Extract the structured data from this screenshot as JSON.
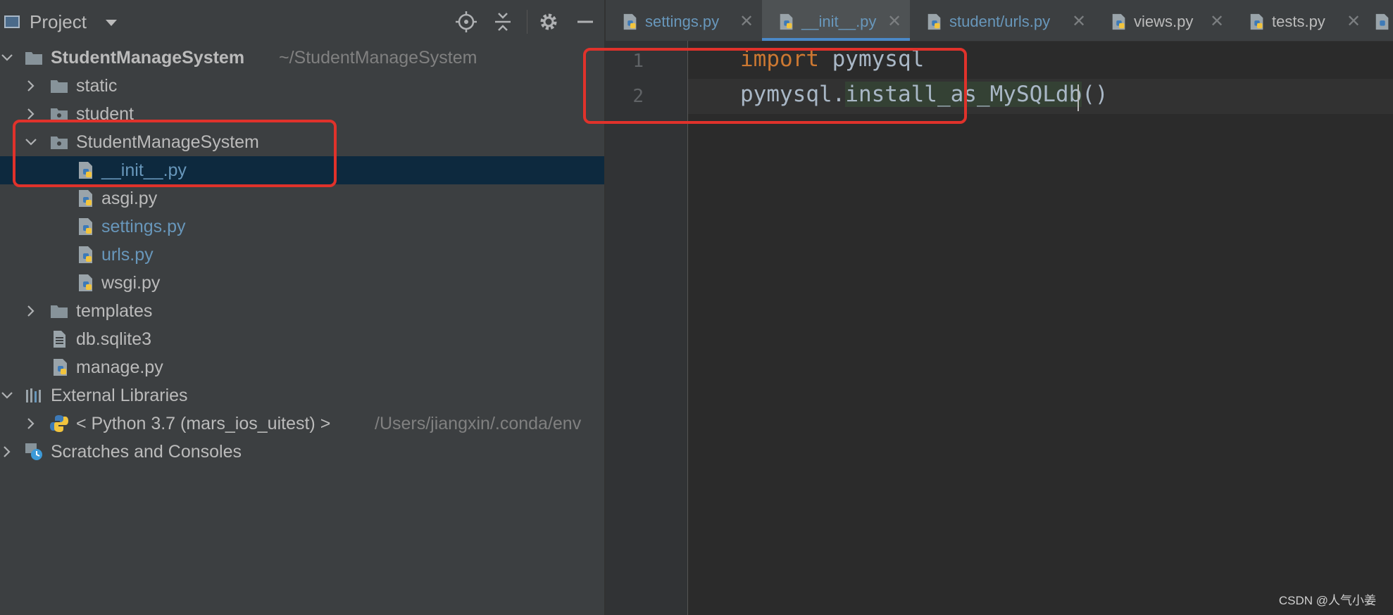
{
  "project": {
    "title": "Project",
    "toolbar_icons": [
      "locate-icon",
      "collapse-all-icon",
      "gear-icon",
      "hide-icon"
    ]
  },
  "tree": {
    "root": {
      "label": "StudentManageSystem",
      "path": "~/StudentManageSystem"
    },
    "static": "static",
    "student": "student",
    "pkg": "StudentManageSystem",
    "init": "__init__.py",
    "asgi": "asgi.py",
    "settings": "settings.py",
    "urls": "urls.py",
    "wsgi": "wsgi.py",
    "templates": "templates",
    "db": "db.sqlite3",
    "manage": "manage.py",
    "ext_libs": "External Libraries",
    "python": "< Python 3.7 (mars_ios_uitest) >",
    "python_path": "/Users/jiangxin/.conda/env",
    "scratches": "Scratches and Consoles"
  },
  "tabs": [
    {
      "label": "settings.py",
      "active": false
    },
    {
      "label": "__init__.py",
      "active": true
    },
    {
      "label": "student/urls.py",
      "active": false
    },
    {
      "label": "views.py",
      "active": false
    },
    {
      "label": "tests.py",
      "active": false
    }
  ],
  "tab_close_glyph": "✕",
  "editor": {
    "line_numbers": [
      "1",
      "2"
    ],
    "line1": {
      "keyword": "import",
      "rest": " pymysql"
    },
    "line2": {
      "object": "pymysql.",
      "call": "install_as_MySQLdb",
      "parens": "()"
    }
  },
  "watermark": "CSDN @人气小姜",
  "colors": {
    "panel_bg": "#3c3f41",
    "editor_bg": "#2b2b2b",
    "selection": "#0d293e",
    "keyword": "#cc7832",
    "link_blue": "#6897bb",
    "highlight_box": "#e0322b"
  }
}
